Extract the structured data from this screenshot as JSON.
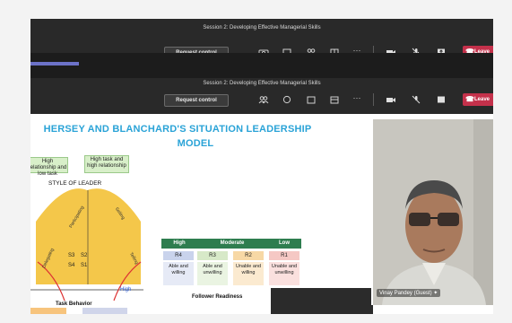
{
  "meeting": {
    "session_title": "Session 2: Developing Effective Managerial Skills",
    "request_control_label": "Request control",
    "leave_label": "Leave",
    "toolbar_icons": [
      "camera-icon",
      "chat-icon",
      "participants-icon",
      "rooms-icon",
      "more-icon",
      "video-icon",
      "mic-icon",
      "share-icon"
    ]
  },
  "slide": {
    "title_line1": "HERSEY AND BLANCHARD'S SITUATION LEADERSHIP",
    "title_line2": "MODEL",
    "box_left": "High relationship and low task",
    "box_right": "High task and high relationship",
    "style_of_leader": "STYLE OF LEADER",
    "quadrants": [
      "S3",
      "S2",
      "S4",
      "S1"
    ],
    "curve_labels": [
      "Participating",
      "Selling",
      "Delegating",
      "Telling"
    ],
    "x_axis_label": "Task Behavior",
    "x_axis_high": "High",
    "follower_table": {
      "headers": [
        "High",
        "Moderate",
        "Low"
      ],
      "levels": [
        "R4",
        "R3",
        "R2",
        "R1"
      ],
      "descriptions": [
        "Able and willing",
        "Able and unwilling",
        "Unable and willing",
        "Unable and unwilling"
      ],
      "caption": "Follower Readiness"
    }
  },
  "webcam": {
    "participant_name": "Vinay Pandey (Guest)"
  },
  "colors": {
    "toolbar_bg": "#292929",
    "leave_red": "#c4314b",
    "slide_title_blue": "#2aa3d7",
    "table_green": "#2e7d4f",
    "curve_yellow": "#f4c74a"
  }
}
